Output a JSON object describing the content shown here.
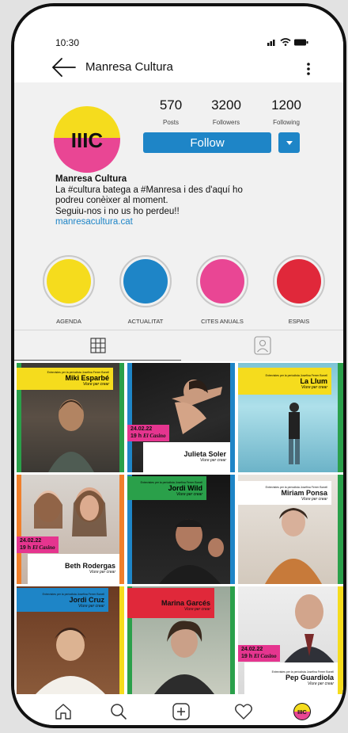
{
  "status": {
    "time": "10:30"
  },
  "header": {
    "title": "Manresa Cultura"
  },
  "profile": {
    "logo_text": "IIIC",
    "stats": [
      {
        "value": "570",
        "label": "Posts"
      },
      {
        "value": "3200",
        "label": "Followers"
      },
      {
        "value": "1200",
        "label": "Following"
      }
    ],
    "follow_label": "Follow",
    "name": "Manresa Cultura",
    "bio_lines": [
      "La #cultura batega a #Manresa i des d'aquí ho",
      "podreu conèixer al moment.",
      "Seguiu-nos i no us ho perdeu!!"
    ],
    "link": "manresacultura.cat"
  },
  "highlights": [
    {
      "label": "AGENDA",
      "color": "#f5dc1d"
    },
    {
      "label": "ACTUALITAT",
      "color": "#1e85c7"
    },
    {
      "label": "CITES ANUALS",
      "color": "#e94694"
    },
    {
      "label": "ESPAIS",
      "color": "#e0283a"
    }
  ],
  "tabs": [
    {
      "name": "grid-icon"
    },
    {
      "name": "tagged-icon"
    }
  ],
  "posts": {
    "tagline": "Viure per crear",
    "fine_print": "Entrevistes per la periodista Josefina Ferrer Bonell",
    "date": "24.02.22",
    "hour": "19 h",
    "venue": "El Casino",
    "items": [
      {
        "name": "Miki Esparbé",
        "banner_color": "#f5dc1d",
        "side_color": "#2aa04a"
      },
      {
        "name": "Julieta Soler",
        "banner_color": "#ffffff",
        "side_color": "#1e85c7"
      },
      {
        "name": "La Llum",
        "banner_color": "#f5dc1d",
        "side_color": "#2aa04a"
      },
      {
        "name": "Beth Rodergas",
        "banner_color": "#ffffff",
        "side_color": "#f07f2b"
      },
      {
        "name": "Jordi Wild",
        "banner_color": "#2aa04a",
        "side_color": "#1e85c7"
      },
      {
        "name": "Miriam Ponsa",
        "banner_color": "#ffffff",
        "side_color": "#2aa04a"
      },
      {
        "name": "Jordi Cruz",
        "banner_color": "#1e85c7",
        "side_color": "#f5dc1d"
      },
      {
        "name": "Marina Garcés",
        "banner_color": "#e0283a",
        "side_color": "#2aa04a"
      },
      {
        "name": "Pep Guardiola",
        "banner_color": "#ffffff",
        "side_color": "#f5dc1d"
      }
    ]
  },
  "nav": [
    {
      "name": "home-icon"
    },
    {
      "name": "search-icon"
    },
    {
      "name": "new-post-icon"
    },
    {
      "name": "activity-heart-icon"
    },
    {
      "name": "profile-avatar-icon"
    }
  ],
  "colors": {
    "accent": "#1e85c7",
    "logo_yellow": "#f5dc1d",
    "logo_pink": "#e94694"
  }
}
